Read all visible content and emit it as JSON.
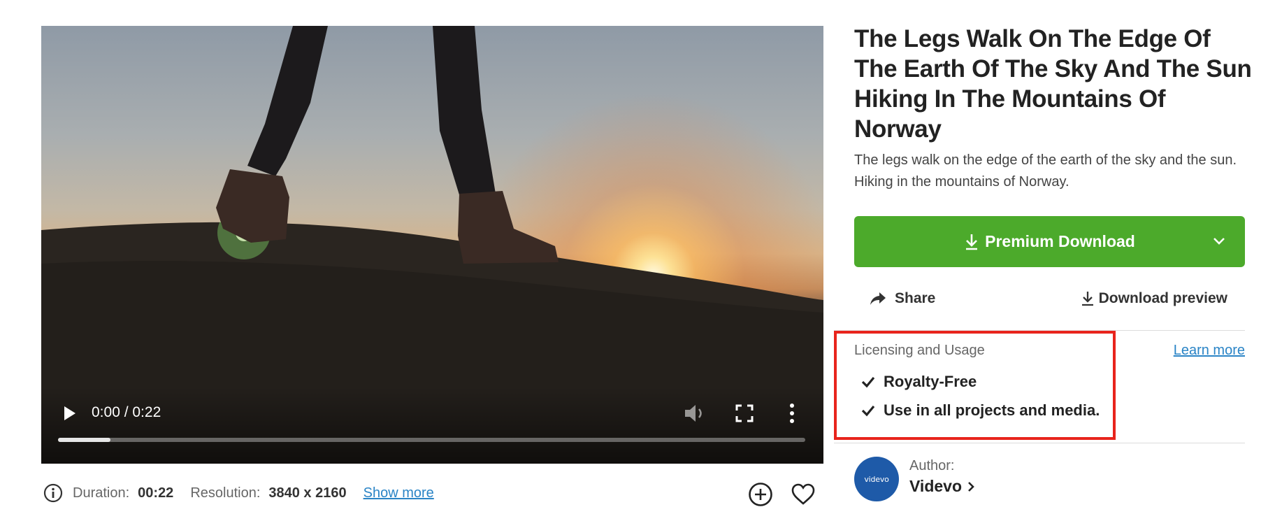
{
  "video": {
    "time_display": "0:00 / 0:22",
    "progress_fraction": 0.07
  },
  "meta": {
    "duration_label": "Duration:",
    "duration_value": "00:22",
    "resolution_label": "Resolution:",
    "resolution_value": "3840 x 2160",
    "show_more": "Show more"
  },
  "title": "The Legs Walk On The Edge Of The Earth Of The Sky And The Sun Hiking In The Mountains Of Norway",
  "description": "The legs walk on the edge of the earth of the sky and the sun. Hiking in the mountains of Norway.",
  "actions": {
    "premium_download": "Premium Download",
    "share": "Share",
    "download_preview": "Download preview"
  },
  "license": {
    "heading": "Licensing and Usage",
    "learn_more": "Learn more",
    "items": [
      "Royalty-Free",
      "Use in all projects and media."
    ]
  },
  "author": {
    "label": "Author:",
    "name": "Videvo",
    "avatar_text": "videvo"
  },
  "colors": {
    "accent_green": "#4caa2b",
    "link_blue": "#2a84c6",
    "highlight_red": "#e8241c",
    "avatar_blue": "#1e5aa8"
  },
  "icons": [
    "play-icon",
    "volume-icon",
    "fullscreen-icon",
    "more-vertical-icon",
    "info-icon",
    "add-circle-icon",
    "heart-icon",
    "download-icon",
    "chevron-down-icon",
    "share-arrow-icon",
    "checkmark-icon",
    "chevron-right-icon"
  ]
}
